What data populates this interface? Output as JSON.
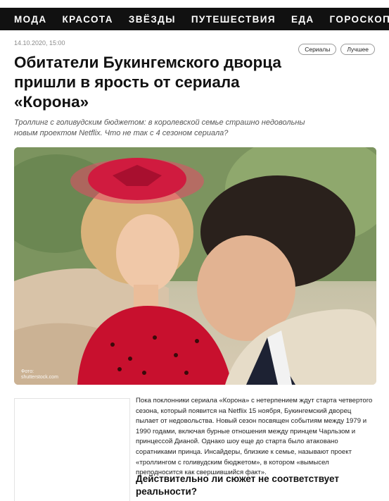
{
  "nav": {
    "items": [
      "МОДА",
      "КРАСОТА",
      "ЗВЁЗДЫ",
      "ПУТЕШЕСТВИЯ",
      "ЕДА",
      "ГОРОСКОП"
    ]
  },
  "article": {
    "date": "14.10.2020, 15:00",
    "tags": [
      "Сериалы",
      "Лучшее"
    ],
    "title": "Обитатели Букингемского дворца пришли в ярость от сериала «Корона»",
    "lead": "Троллинг с голивудским бюджетом: в королевской семье страшно недовольны новым проектом Netflix. Что не так с 4 сезоном сериала?",
    "photo_credit_line1": "Фото:",
    "photo_credit_line2": "shutterstock.com",
    "body": "Пока поклонники сериала «Корона» с нетерпением ждут старта четвертого сезона, который появится на Netflix 15 ноября, Букингемский дворец пылает от недовольства. Новый сезон посвящен событиям между 1979 и 1990 годами, включая бурные отношения между принцем Чарльзом и принцессой Дианой. Однако шоу еще до старта было атаковано соратниками принца. Инсайдеры, близкие к семье, называют проект «троллингом с голивудским бюджетом», в котором «вымысел преподносится как свершившийся факт».",
    "subhead": "Действительно ли сюжет не соответствует реальности?"
  },
  "colors": {
    "nav_bg": "#111111",
    "hat_red": "#d01b3f",
    "dress_red": "#c8102e"
  }
}
